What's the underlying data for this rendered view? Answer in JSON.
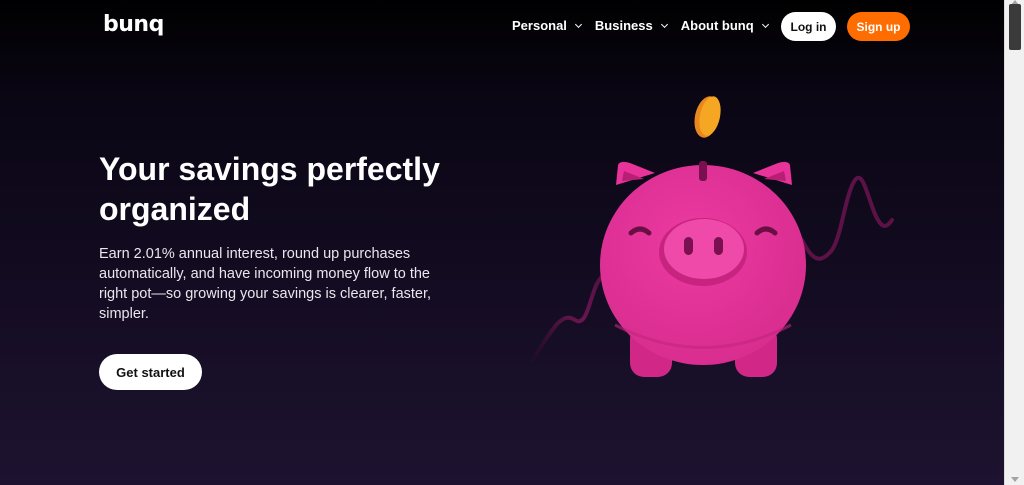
{
  "header": {
    "logo": "bunq",
    "nav": [
      {
        "label": "Personal"
      },
      {
        "label": "Business"
      },
      {
        "label": "About bunq"
      }
    ],
    "login_label": "Log in",
    "signup_label": "Sign up"
  },
  "hero": {
    "title": "Your savings perfectly organized",
    "description": "Earn 2.01% annual interest, round up purchases automatically, and have incoming money flow to the right pot—so growing your savings is clearer, faster, simpler.",
    "cta_label": "Get started"
  },
  "colors": {
    "accent": "#ff6d00",
    "pig": "#e8339a",
    "coin": "#f5a623",
    "background": "#0b0612"
  },
  "icons": {
    "nav_chevron": "chevron-down-icon",
    "illustration": "piggy-bank-icon"
  }
}
